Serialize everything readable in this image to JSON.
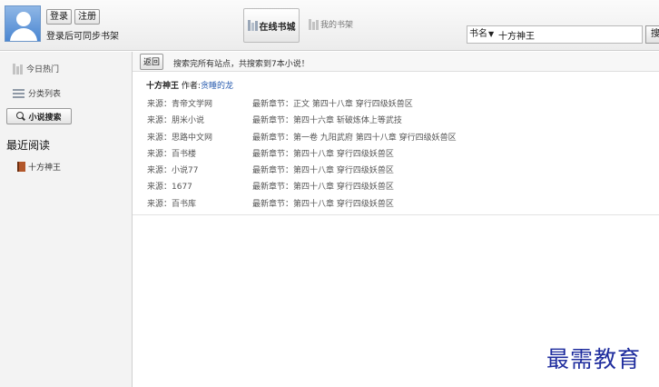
{
  "header": {
    "login_label": "登录",
    "register_label": "注册",
    "sync_tip": "登录后可同步书架",
    "tab_online": "在线书城",
    "tab_shelf": "我的书架",
    "search_type": "书名",
    "search_value": "十方神王",
    "search_button": "搜索"
  },
  "sidebar": {
    "hot_today": "今日热门",
    "category_list": "分类列表",
    "novel_search": "小说搜索",
    "recent_title": "最近阅读",
    "recent_items": [
      {
        "title": "十方神王"
      }
    ]
  },
  "main": {
    "back_label": "返回",
    "status": "搜索完所有站点，共搜索到7本小说！",
    "book": {
      "title": "十方神王",
      "author_label": "作者:",
      "author": "贪睡的龙"
    },
    "sources": [
      {
        "source": "来源：青帝文学网",
        "latest": "最新章节：正文 第四十八章 穿行四级妖兽区"
      },
      {
        "source": "来源：朋米小说",
        "latest": "最新章节：第四十六章 斩破炼体上等武技"
      },
      {
        "source": "来源：思路中文网",
        "latest": "最新章节：第一卷 九阳武府 第四十八章 穿行四级妖兽区"
      },
      {
        "source": "来源：百书楼",
        "latest": "最新章节：第四十八章 穿行四级妖兽区"
      },
      {
        "source": "来源：小说77",
        "latest": "最新章节：第四十八章 穿行四级妖兽区"
      },
      {
        "source": "来源：1677",
        "latest": "最新章节：第四十八章 穿行四级妖兽区"
      },
      {
        "source": "来源：百书库",
        "latest": "最新章节：第四十八章 穿行四级妖兽区"
      }
    ]
  },
  "watermark": "最需教育"
}
